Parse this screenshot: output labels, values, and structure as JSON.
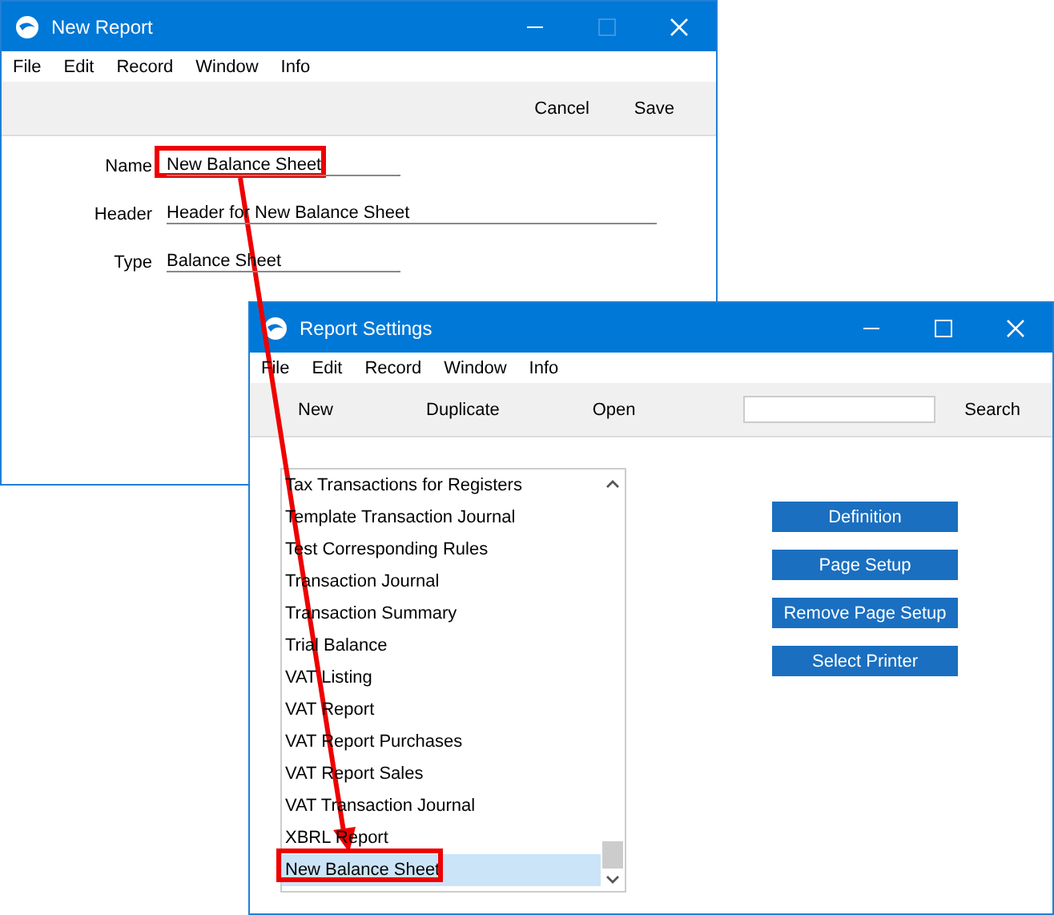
{
  "new_report_window": {
    "title": "New Report",
    "menu": [
      "File",
      "Edit",
      "Record",
      "Window",
      "Info"
    ],
    "toolbar": [
      "Cancel",
      "Save"
    ],
    "fields": [
      {
        "label": "Name",
        "value": "New Balance Sheet",
        "kind": "short"
      },
      {
        "label": "Header",
        "value": "Header for New Balance Sheet",
        "kind": "long"
      },
      {
        "label": "Type",
        "value": "Balance Sheet",
        "kind": "short"
      }
    ]
  },
  "report_settings_window": {
    "title": "Report Settings",
    "menu": [
      "File",
      "Edit",
      "Record",
      "Window",
      "Info"
    ],
    "toolbar": [
      "New",
      "Duplicate",
      "Open"
    ],
    "search_button": "Search",
    "list": [
      {
        "label": "Tax Transactions for Registers",
        "selected": false
      },
      {
        "label": "Template Transaction Journal",
        "selected": false
      },
      {
        "label": "Test Corresponding Rules",
        "selected": false
      },
      {
        "label": "Transaction Journal",
        "selected": false
      },
      {
        "label": "Transaction Summary",
        "selected": false
      },
      {
        "label": "Trial Balance",
        "selected": false
      },
      {
        "label": "VAT Listing",
        "selected": false
      },
      {
        "label": "VAT Report",
        "selected": false
      },
      {
        "label": "VAT Report Purchases",
        "selected": false
      },
      {
        "label": "VAT Report Sales",
        "selected": false
      },
      {
        "label": "VAT Transaction Journal",
        "selected": false
      },
      {
        "label": "XBRL Report",
        "selected": false
      },
      {
        "label": "New Balance Sheet",
        "selected": true
      }
    ],
    "actions": [
      "Definition",
      "Page Setup",
      "Remove Page Setup",
      "Select Printer"
    ]
  }
}
